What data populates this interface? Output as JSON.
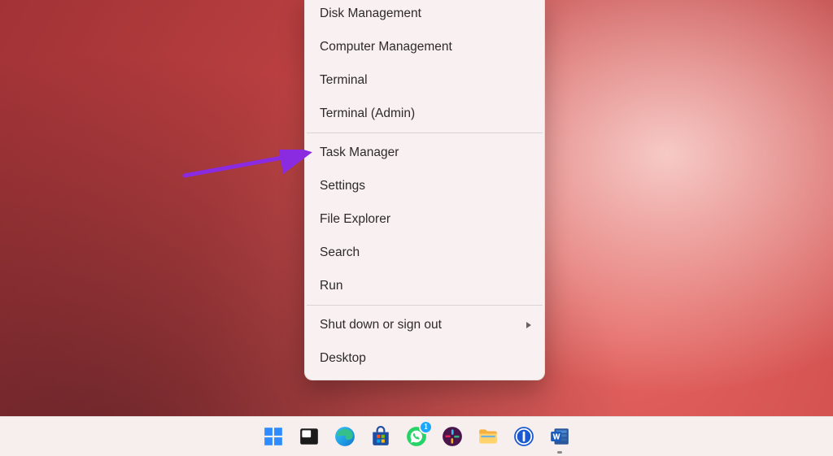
{
  "menu": {
    "groups": [
      {
        "items": [
          {
            "label": "Disk Management",
            "name": "menu-item-disk-management"
          },
          {
            "label": "Computer Management",
            "name": "menu-item-computer-management"
          },
          {
            "label": "Terminal",
            "name": "menu-item-terminal"
          },
          {
            "label": "Terminal (Admin)",
            "name": "menu-item-terminal-admin"
          }
        ]
      },
      {
        "items": [
          {
            "label": "Task Manager",
            "name": "menu-item-task-manager"
          },
          {
            "label": "Settings",
            "name": "menu-item-settings"
          },
          {
            "label": "File Explorer",
            "name": "menu-item-file-explorer"
          },
          {
            "label": "Search",
            "name": "menu-item-search"
          },
          {
            "label": "Run",
            "name": "menu-item-run"
          }
        ]
      },
      {
        "items": [
          {
            "label": "Shut down or sign out",
            "name": "menu-item-shutdown",
            "submenu": true
          },
          {
            "label": "Desktop",
            "name": "menu-item-desktop"
          }
        ]
      }
    ]
  },
  "arrow_color": "#8a2be2",
  "taskbar": {
    "items": [
      {
        "name": "start-button",
        "icon": "start-icon"
      },
      {
        "name": "task-view-button",
        "icon": "task-view-icon"
      },
      {
        "name": "edge-button",
        "icon": "edge-icon"
      },
      {
        "name": "store-button",
        "icon": "store-icon"
      },
      {
        "name": "whatsapp-button",
        "icon": "whatsapp-icon",
        "badge": "1"
      },
      {
        "name": "slack-button",
        "icon": "slack-icon"
      },
      {
        "name": "file-explorer-button",
        "icon": "folder-icon"
      },
      {
        "name": "1password-button",
        "icon": "onepassword-icon"
      },
      {
        "name": "word-button",
        "icon": "word-icon",
        "running": true
      }
    ]
  }
}
